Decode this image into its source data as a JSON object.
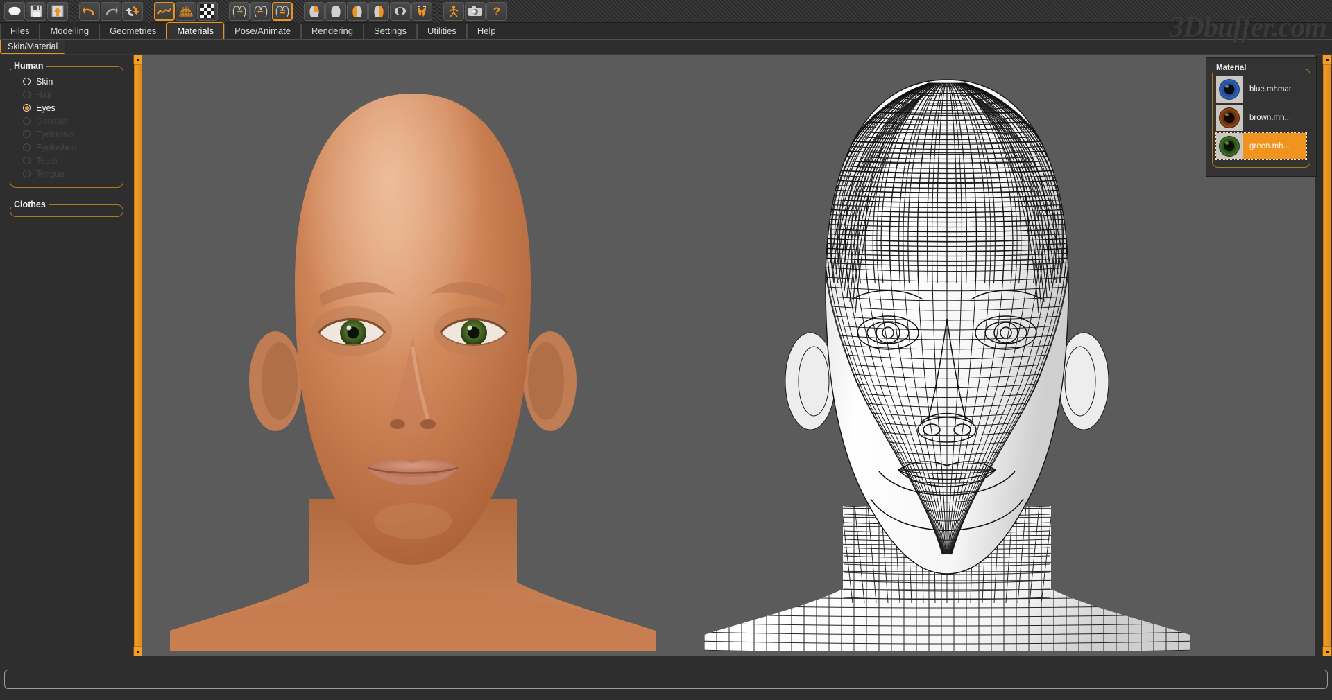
{
  "app": {
    "watermark": "3Dbuffer.com"
  },
  "toolbar": {
    "groups": [
      {
        "name": "file-group",
        "buttons": [
          {
            "icon": "new-mesh-icon",
            "label": "New",
            "state": "normal"
          },
          {
            "icon": "save-icon",
            "label": "Save",
            "state": "normal"
          },
          {
            "icon": "load-icon",
            "label": "Load",
            "state": "normal"
          }
        ]
      },
      {
        "name": "history-group",
        "buttons": [
          {
            "icon": "undo-icon",
            "label": "Undo",
            "state": "normal"
          },
          {
            "icon": "redo-icon",
            "label": "Redo",
            "state": "disabled"
          },
          {
            "icon": "reset-icon",
            "label": "Reset Mesh",
            "state": "normal"
          }
        ]
      },
      {
        "name": "shading-group",
        "buttons": [
          {
            "icon": "smooth-icon",
            "label": "Smooth",
            "state": "selected"
          },
          {
            "icon": "wireframe-icon",
            "label": "Wireframe",
            "state": "normal"
          },
          {
            "icon": "subdivide-icon",
            "label": "Subdivide",
            "state": "normal"
          }
        ]
      },
      {
        "name": "symmetry-group",
        "buttons": [
          {
            "icon": "symmetry-right-icon",
            "label": "Symmetry Right",
            "state": "normal"
          },
          {
            "icon": "symmetry-left-icon",
            "label": "Symmetry Left",
            "state": "normal"
          },
          {
            "icon": "symmetry-both-icon",
            "label": "Symmetry",
            "state": "selected"
          }
        ]
      },
      {
        "name": "view-group",
        "buttons": [
          {
            "icon": "view-front-icon",
            "label": "Front View",
            "state": "normal"
          },
          {
            "icon": "view-back-icon",
            "label": "Back View",
            "state": "normal"
          },
          {
            "icon": "view-left-icon",
            "label": "Left View",
            "state": "normal"
          },
          {
            "icon": "view-right-icon",
            "label": "Right View",
            "state": "normal"
          },
          {
            "icon": "view-top-icon",
            "label": "Top View",
            "state": "normal"
          },
          {
            "icon": "view-bottom-icon",
            "label": "Bottom View",
            "state": "normal"
          }
        ]
      },
      {
        "name": "extras-group",
        "buttons": [
          {
            "icon": "pose-icon",
            "label": "Reset Camera",
            "state": "normal"
          },
          {
            "icon": "grab-screen-icon",
            "label": "Grab Screen",
            "state": "normal"
          },
          {
            "icon": "help-icon",
            "label": "Help",
            "state": "normal"
          }
        ]
      }
    ]
  },
  "tabs": {
    "items": [
      {
        "label": "Files",
        "active": false
      },
      {
        "label": "Modelling",
        "active": false
      },
      {
        "label": "Geometries",
        "active": false
      },
      {
        "label": "Materials",
        "active": true
      },
      {
        "label": "Pose/Animate",
        "active": false
      },
      {
        "label": "Rendering",
        "active": false
      },
      {
        "label": "Settings",
        "active": false
      },
      {
        "label": "Utilities",
        "active": false
      },
      {
        "label": "Help",
        "active": false
      }
    ]
  },
  "subtabs": {
    "items": [
      {
        "label": "Skin/Material",
        "active": true
      }
    ]
  },
  "left_panel": {
    "human_group": {
      "title": "Human",
      "options": [
        {
          "label": "Skin",
          "selected": false,
          "disabled": false
        },
        {
          "label": "Hair",
          "selected": false,
          "disabled": true
        },
        {
          "label": "Eyes",
          "selected": true,
          "disabled": false
        },
        {
          "label": "Genitals",
          "selected": false,
          "disabled": true
        },
        {
          "label": "Eyebrows",
          "selected": false,
          "disabled": true
        },
        {
          "label": "Eyelashes",
          "selected": false,
          "disabled": true
        },
        {
          "label": "Teeth",
          "selected": false,
          "disabled": true
        },
        {
          "label": "Tongue",
          "selected": false,
          "disabled": true
        }
      ]
    },
    "clothes_group": {
      "title": "Clothes",
      "options": []
    }
  },
  "material_panel": {
    "title": "Material",
    "items": [
      {
        "label": "blue.mhmat",
        "icon": "eye-swatch-blue-icon",
        "iris": "#2b5fb0",
        "pupil": "#0a0a12",
        "selected": false
      },
      {
        "label": "brown.mh...",
        "icon": "eye-swatch-brown-icon",
        "iris": "#8a4418",
        "pupil": "#120a04",
        "selected": false
      },
      {
        "label": "green.mh...",
        "icon": "eye-swatch-green-icon",
        "iris": "#3f6a22",
        "pupil": "#0a1206",
        "selected": true
      }
    ]
  },
  "viewport": {
    "background": "#5b5b5b",
    "models": [
      {
        "name": "textured-head",
        "shading": "smooth",
        "skin_color": "#c97e55",
        "eye_color": "#3f6a22"
      },
      {
        "name": "wireframe-head",
        "shading": "wireframe",
        "skin_color": "#f4f4f4",
        "wire_color": "#141414"
      }
    ]
  },
  "scrollbars": {
    "left": {
      "orientation": "vertical",
      "color": "#ef9a23"
    },
    "right": {
      "orientation": "vertical",
      "color": "#ef9a23"
    }
  },
  "statusbar": {
    "text": ""
  }
}
